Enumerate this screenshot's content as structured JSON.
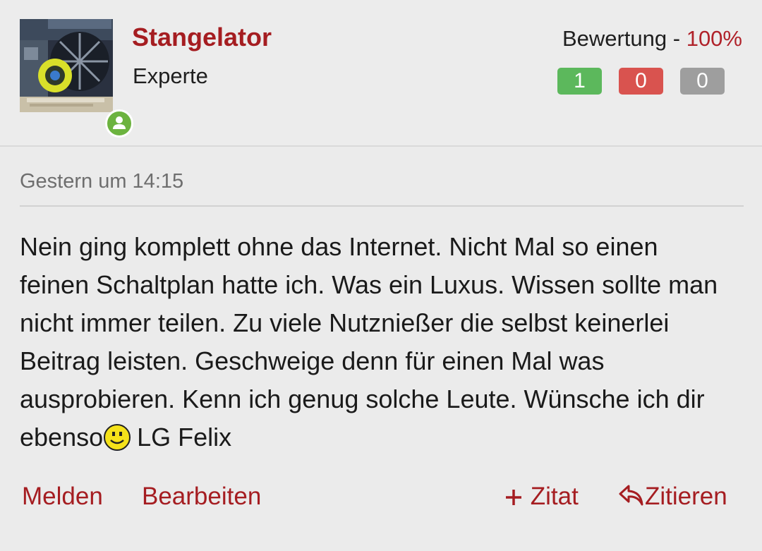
{
  "user": {
    "name": "Stangelator",
    "rank": "Experte",
    "avatar_icon": "graphics-card-avatar",
    "online_badge_icon": "user-online-icon"
  },
  "rating": {
    "label": "Bewertung - ",
    "percent": "100%",
    "positive": "1",
    "negative": "0",
    "neutral": "0"
  },
  "post": {
    "date": "Gestern um 14:15",
    "text_before_smiley": "Nein ging komplett ohne das Internet. Nicht Mal so einen feinen Schaltplan hatte ich. Was ein Luxus. Wissen sollte man nicht immer teilen. Zu viele Nutznießer die selbst keinerlei Beitrag leisten. Geschweige denn für einen Mal was ausprobieren. Kenn ich genug solche Leute. Wünsche ich dir ebenso",
    "smiley_icon": "smiley-icon",
    "text_after_smiley": "LG Felix"
  },
  "actions": {
    "report": "Melden",
    "edit": "Bearbeiten",
    "add_quote": "Zitat",
    "reply_quote": "Zitieren"
  },
  "colors": {
    "accent": "#a51d21",
    "positive": "#5cb85c",
    "negative": "#d9534f",
    "neutral": "#9e9e9e"
  }
}
